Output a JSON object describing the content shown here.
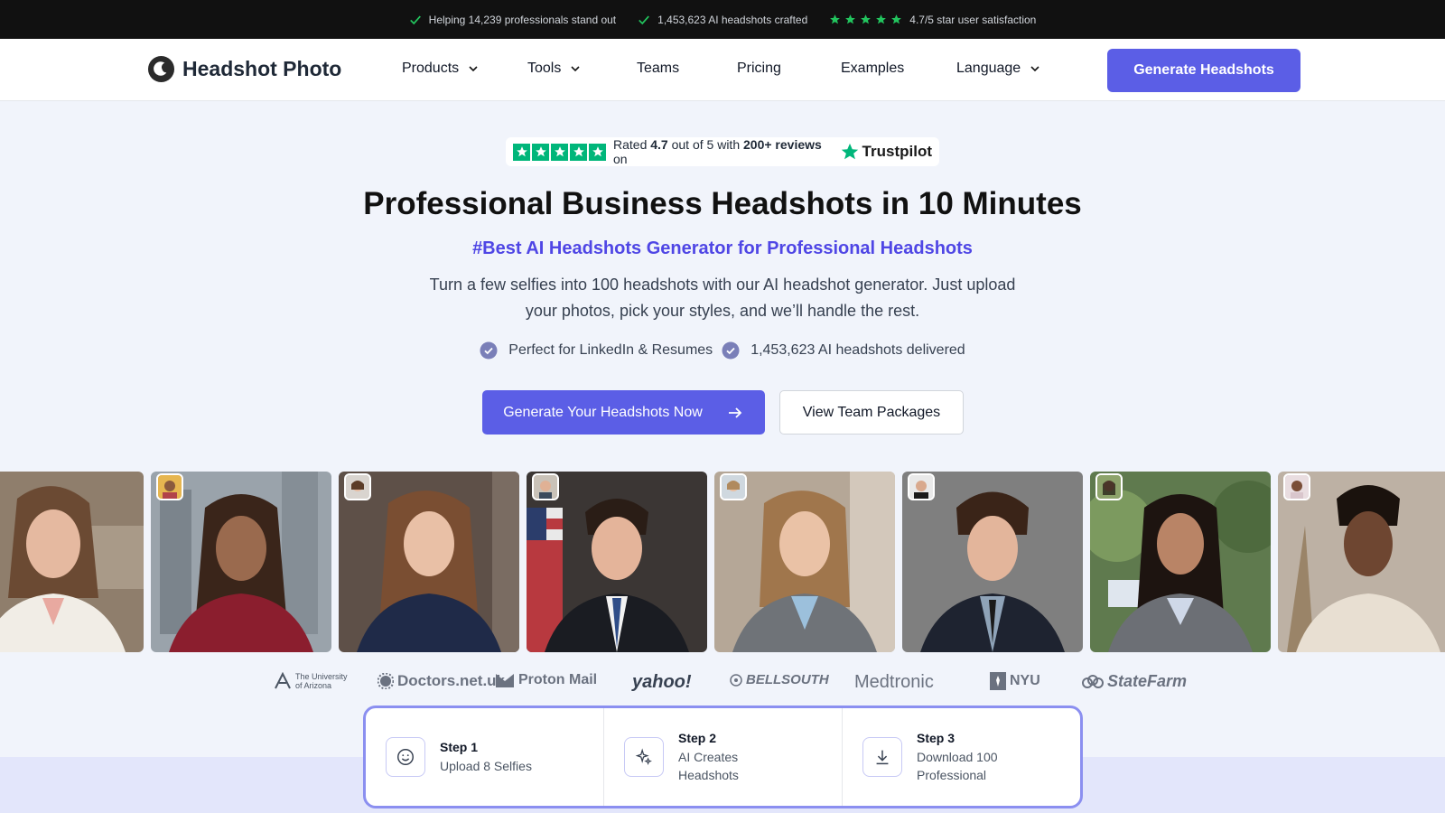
{
  "topbar": {
    "item1": "Helping 14,239 professionals stand out",
    "item2": "1,453,623 AI headshots crafted",
    "item3": "4.7/5 star user satisfaction"
  },
  "nav": {
    "logo": "Headshot Photo",
    "items": [
      "Products",
      "Tools",
      "Teams",
      "Pricing",
      "Examples",
      "Language"
    ],
    "cta": "Generate Headshots"
  },
  "trustpilot": {
    "rated": "Rated",
    "score": "4.7",
    "out_of": "out of 5 with",
    "reviews": "200+ reviews",
    "on": "on",
    "brand": "Trustpilot"
  },
  "hero": {
    "title": "Professional Business Headshots in 10 Minutes",
    "subtitle": "#Best AI Headshots Generator for Professional Headshots",
    "description": "Turn a few selfies into 100 headshots with our AI headshot generator. Just upload your photos, pick your styles, and we’ll handle the rest.",
    "bullet1": "Perfect for LinkedIn & Resumes",
    "bullet2": "1,453,623 AI headshots delivered",
    "cta_primary": "Generate Your Headshots Now",
    "cta_secondary": "View Team Packages"
  },
  "logos": {
    "arizona": "The University of Arizona",
    "doctors": "Doctors.net.uk",
    "proton": "Proton Mail",
    "yahoo": "yahoo!",
    "bellsouth": "BELLSOUTH",
    "medtronic": "Medtronic",
    "nyu": "NYU",
    "statefarm": "StateFarm"
  },
  "steps": [
    {
      "num": "Step 1",
      "text": "Upload 8 Selfies"
    },
    {
      "num": "Step 2",
      "text": "AI Creates Headshots"
    },
    {
      "num": "Step 3",
      "text": "Download 100 Professional"
    }
  ],
  "colors": {
    "accent": "#5b5ee6",
    "subtitle": "#4f46e5",
    "topbar_bg": "#111111",
    "check_green": "#22c55e",
    "trustpilot_green": "#00b67a"
  }
}
